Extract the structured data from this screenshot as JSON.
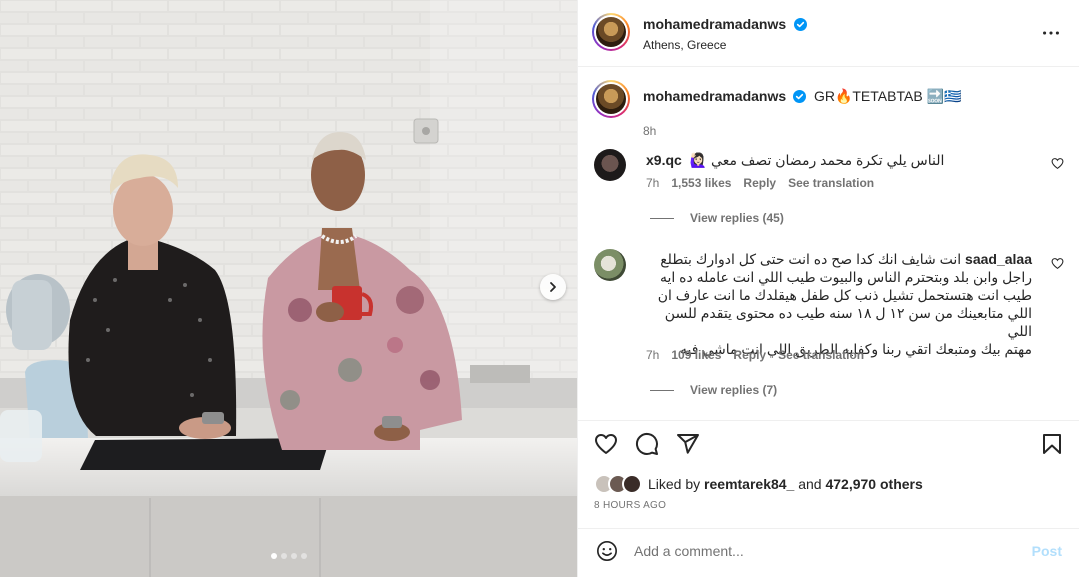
{
  "post": {
    "author": "mohamedramadanws",
    "location": "Athens, Greece",
    "caption": "GR🔥TETABTAB 🔜🇬🇷",
    "caption_time": "8h"
  },
  "carousel": {
    "slide_count": 4,
    "active_slide": 1
  },
  "comments": [
    {
      "user": "x9.qc",
      "text": "الناس يلي تكرة محمد رمضان تصف معي 🙋🏻‍♀️",
      "time": "7h",
      "likes": "1,553 likes",
      "reply": "Reply",
      "translate": "See translation",
      "view_replies": "View replies (45)"
    },
    {
      "user": "saad_alaa",
      "lines": [
        "انت شايف انك كدا صح ده انت حتى كل ادوارك بتطلع",
        "راجل وابن بلد وبتحترم الناس والبيوت طيب اللي انت عامله ده ايه",
        "طيب انت هتستحمل تشيل ذنب كل طفل هيقلدك ما انت عارف ان",
        "اللي متابعينك من سن ١٢ ل ١٨ سنه طيب ده محتوى يتقدم للسن اللي",
        "مهتم بيك ومتبعك اتقي ربنا وكفايه الطريق اللي انت ماشي فيه"
      ],
      "time": "7h",
      "likes": "109 likes",
      "reply": "Reply",
      "translate": "See translation",
      "view_replies": "View replies (7)"
    }
  ],
  "likes": {
    "prefix": "Liked by",
    "user": "reemtarek84_",
    "middle": "and",
    "others": "472,970 others"
  },
  "time_ago": "8 HOURS AGO",
  "add_comment": {
    "placeholder": "Add a comment...",
    "post_label": "Post"
  },
  "colors": {
    "verified": "#0095f6",
    "post_disabled": "#b2dffc",
    "secondary_text": "#737373"
  },
  "icons": {
    "more": "more-options-icon",
    "like": "heart-icon",
    "comment": "comment-icon",
    "share": "send-icon",
    "save": "bookmark-icon",
    "emoji": "emoji-icon",
    "next": "chevron-right-icon"
  }
}
